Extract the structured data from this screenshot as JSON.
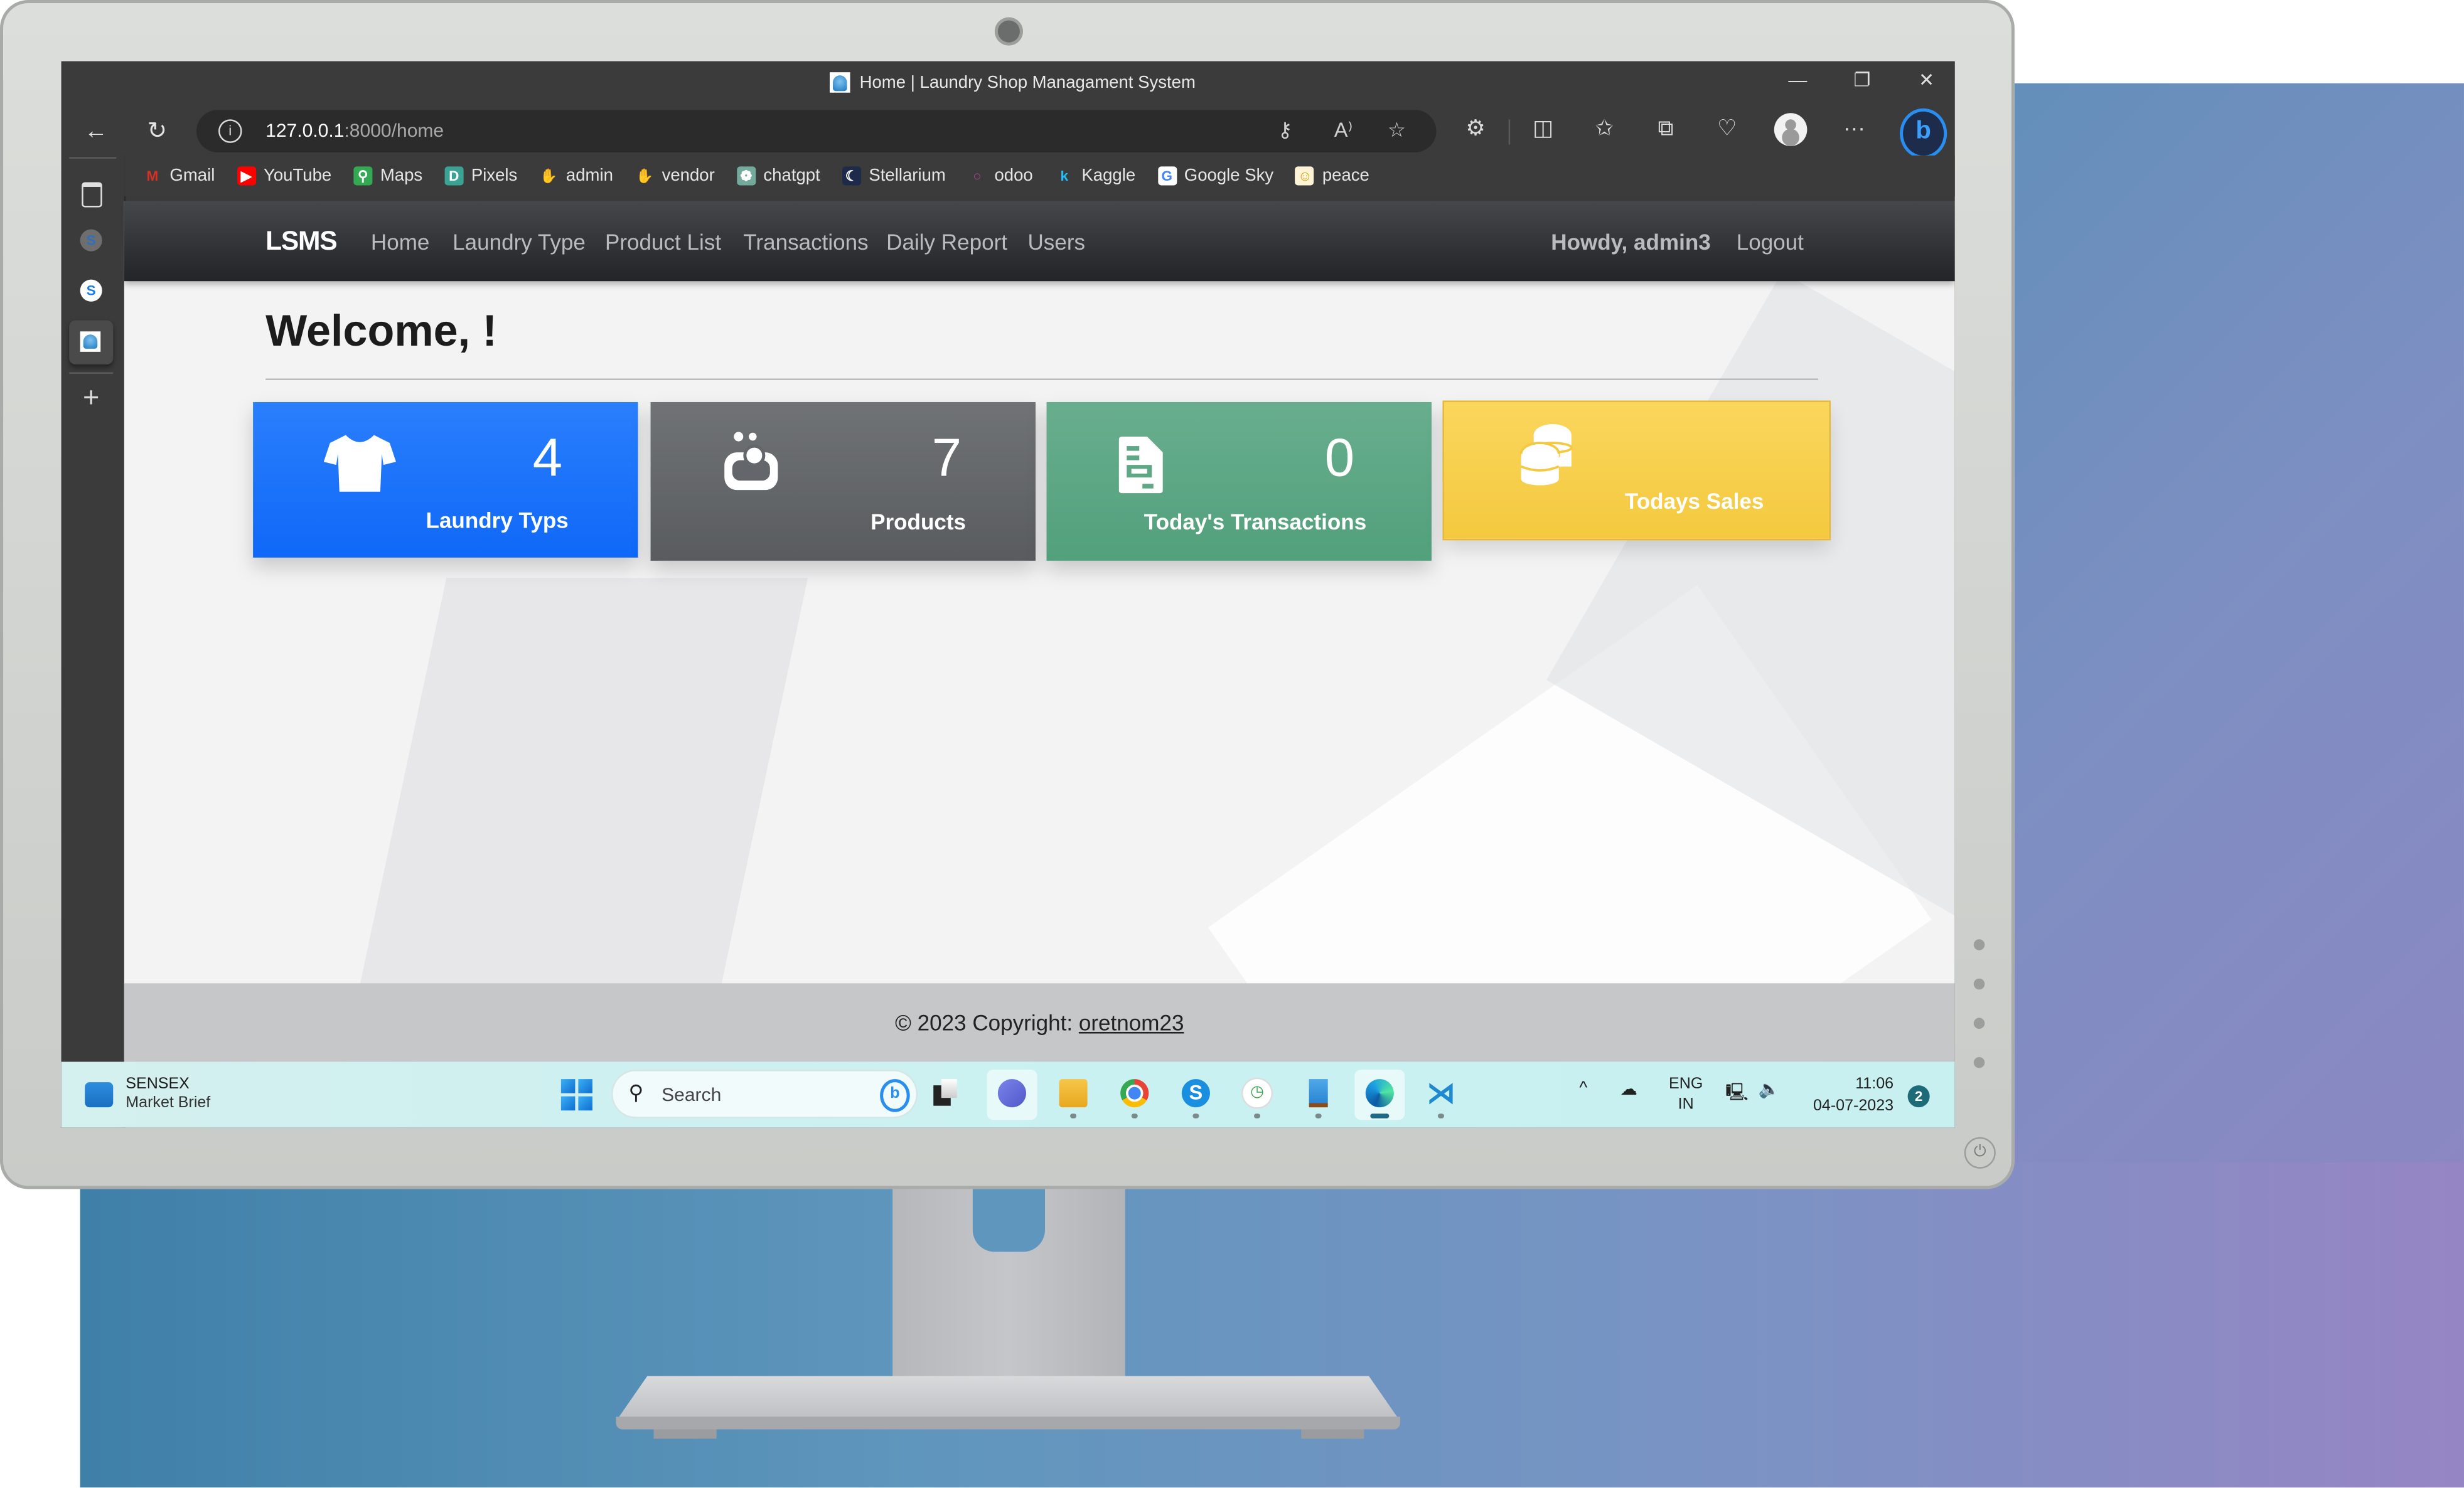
{
  "window": {
    "title": "Home | Laundry Shop Managament System",
    "controls": {
      "minimize": "—",
      "restore": "❐",
      "close": "✕"
    }
  },
  "browser": {
    "url_host": "127.0.0.1",
    "url_rest": ":8000/home",
    "back_icon": "←",
    "refresh_icon": "↻",
    "toolbar_icons": [
      "key-icon",
      "read-aloud-icon",
      "favorite-star-icon",
      "extensions-icon",
      "split-screen-icon",
      "favorites-icon",
      "collections-icon",
      "browser-essentials-icon",
      "profile-icon",
      "more-icon",
      "bing-copilot-icon"
    ],
    "more_label": "···",
    "bing_label": "b"
  },
  "bookmarks": [
    {
      "label": "Gmail",
      "glyph": "M",
      "color": "#d93025",
      "bg": "transparent"
    },
    {
      "label": "YouTube",
      "glyph": "▶",
      "color": "#ffffff",
      "bg": "#ff0000"
    },
    {
      "label": "Maps",
      "glyph": "⚲",
      "color": "#ffffff",
      "bg": "#34a853"
    },
    {
      "label": "Pixels",
      "glyph": "D",
      "color": "#ffffff",
      "bg": "#3aa394"
    },
    {
      "label": "admin",
      "glyph": "✋",
      "color": "#e2b93b",
      "bg": "transparent"
    },
    {
      "label": "vendor",
      "glyph": "✋",
      "color": "#e2b93b",
      "bg": "transparent"
    },
    {
      "label": "chatgpt",
      "glyph": "❁",
      "color": "#ffffff",
      "bg": "#74aa9c"
    },
    {
      "label": "Stellarium",
      "glyph": "☾",
      "color": "#ffffff",
      "bg": "#1e2a4a"
    },
    {
      "label": "odoo",
      "glyph": "○",
      "color": "#a24689",
      "bg": "transparent"
    },
    {
      "label": "Kaggle",
      "glyph": "k",
      "color": "#20beff",
      "bg": "transparent"
    },
    {
      "label": "Google Sky",
      "glyph": "G",
      "color": "#4285f4",
      "bg": "#ffffff"
    },
    {
      "label": "peace",
      "glyph": "☺",
      "color": "#d4a017",
      "bg": "#fff4d6"
    }
  ],
  "vertical_tabs": [
    "tab-actions-icon",
    "skype-tab-grey",
    "skype-tab",
    "lsms-tab-active",
    "new-tab-plus"
  ],
  "app": {
    "brand": "LSMS",
    "nav": [
      "Home",
      "Laundry Type",
      "Product List",
      "Transactions",
      "Daily Report",
      "Users"
    ],
    "greeting": "Howdy, admin3",
    "logout": "Logout",
    "welcome": "Welcome,  !",
    "cards": [
      {
        "label": "Laundry Typs",
        "value": "4",
        "icon": "shirt-icon",
        "color": "#1a72fb"
      },
      {
        "label": "Products",
        "value": "7",
        "icon": "soap-icon",
        "color": "#64686b"
      },
      {
        "label": "Today's Transactions",
        "value": "0",
        "icon": "file-invoice-icon",
        "color": "#5ea886"
      },
      {
        "label": "Todays Sales",
        "value": "",
        "icon": "coins-icon",
        "color": "#f6cd4a"
      }
    ],
    "footer_prefix": "© 2023 Copyright: ",
    "footer_link": "oretnom23"
  },
  "taskbar": {
    "widget_title": "SENSEX",
    "widget_subtitle": "Market Brief",
    "search_placeholder": "Search",
    "apps": [
      "task-view",
      "teams-meet",
      "file-explorer",
      "chrome",
      "skype",
      "clock-app",
      "notepad",
      "edge",
      "vscode"
    ],
    "language_top": "ENG",
    "language_bottom": "IN",
    "time": "11:06",
    "date": "04-07-2023",
    "notification_count": "2"
  }
}
